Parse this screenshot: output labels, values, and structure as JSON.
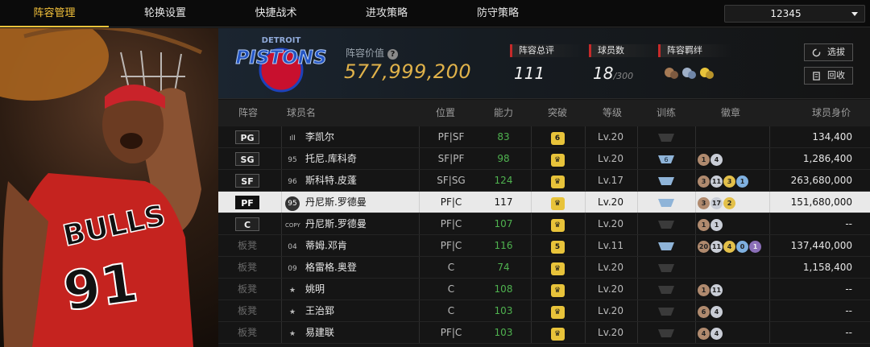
{
  "nav": {
    "tabs": [
      "阵容管理",
      "轮换设置",
      "快捷战术",
      "进攻策略",
      "防守策略"
    ],
    "active_index": 0,
    "selector_value": "12345"
  },
  "header": {
    "team_logo_text": "PISTONS",
    "team_logo_subtext": "DETROIT",
    "value_label": "阵容价值",
    "value": "577,999,200",
    "rating_label": "阵容总评",
    "rating": "111",
    "count_label": "球员数",
    "count": "18",
    "count_max": "/300",
    "bond_label": "阵容羁绊",
    "btn_select": "选拔",
    "btn_recycle": "回收"
  },
  "player_art": {
    "jersey_text": "BULLS",
    "jersey_number": "91"
  },
  "table": {
    "headers": {
      "slot": "阵容",
      "name": "球员名",
      "pos": "位置",
      "ability": "能力",
      "breakthrough": "突破",
      "level": "等级",
      "training": "训练",
      "badges": "徽章",
      "value": "球员身价"
    },
    "rows": [
      {
        "slot": "PG",
        "bench": false,
        "num": "ıII",
        "name": "李凯尔",
        "pos": "PF|SF",
        "ability": "83",
        "brk": "6",
        "level": "Lv.20",
        "badges": [],
        "value": "134,400"
      },
      {
        "slot": "SG",
        "bench": false,
        "num": "95",
        "name": "托尼.库科奇",
        "pos": "SF|PF",
        "ability": "98",
        "brk": "♛",
        "level": "Lv.20",
        "train": "6",
        "badges": [
          "1",
          "4"
        ],
        "value": "1,286,400"
      },
      {
        "slot": "SF",
        "bench": false,
        "num": "96",
        "name": "斯科特.皮蓬",
        "pos": "SF|SG",
        "ability": "124",
        "brk": "♛",
        "level": "Lv.17",
        "badges": [
          "3",
          "11",
          "3",
          "1"
        ],
        "value": "263,680,000"
      },
      {
        "slot": "PF",
        "bench": false,
        "num": "95",
        "name": "丹尼斯.罗德曼",
        "pos": "PF|C",
        "ability": "117",
        "brk": "♛",
        "level": "Lv.20",
        "badges": [
          "3",
          "17",
          "2"
        ],
        "value": "151,680,000",
        "selected": true
      },
      {
        "slot": "C",
        "bench": false,
        "num": "COPY",
        "name": "丹尼斯.罗德曼",
        "pos": "PF|C",
        "ability": "107",
        "brk": "♛",
        "level": "Lv.20",
        "badges": [
          "1",
          "1"
        ],
        "value": "--"
      },
      {
        "slot": "板凳",
        "bench": true,
        "num": "04",
        "name": "蒂姆.邓肯",
        "pos": "PF|C",
        "ability": "116",
        "brk": "5",
        "level": "Lv.11",
        "badges": [
          "20",
          "11",
          "4",
          "0",
          "1"
        ],
        "value": "137,440,000"
      },
      {
        "slot": "板凳",
        "bench": true,
        "num": "09",
        "name": "格雷格.奥登",
        "pos": "C",
        "ability": "74",
        "brk": "♛",
        "level": "Lv.20",
        "badges": [],
        "value": "1,158,400"
      },
      {
        "slot": "板凳",
        "bench": true,
        "num": "★",
        "name": "姚明",
        "pos": "C",
        "ability": "108",
        "brk": "♛",
        "level": "Lv.20",
        "badges": [
          "1",
          "11"
        ],
        "value": "--"
      },
      {
        "slot": "板凳",
        "bench": true,
        "num": "★",
        "name": "王治郅",
        "pos": "C",
        "ability": "103",
        "brk": "♛",
        "level": "Lv.20",
        "badges": [
          "6",
          "4"
        ],
        "value": "--"
      },
      {
        "slot": "板凳",
        "bench": true,
        "num": "★",
        "name": "易建联",
        "pos": "PF|C",
        "ability": "103",
        "brk": "♛",
        "level": "Lv.20",
        "badges": [
          "4",
          "4"
        ],
        "value": "--"
      }
    ]
  },
  "colors": {
    "accent": "#f5c33b",
    "value_gold": "#e0b24a",
    "ability_green": "#4fb24f",
    "label_red": "#c62a2a",
    "selected_row": "#e9e9e9"
  }
}
